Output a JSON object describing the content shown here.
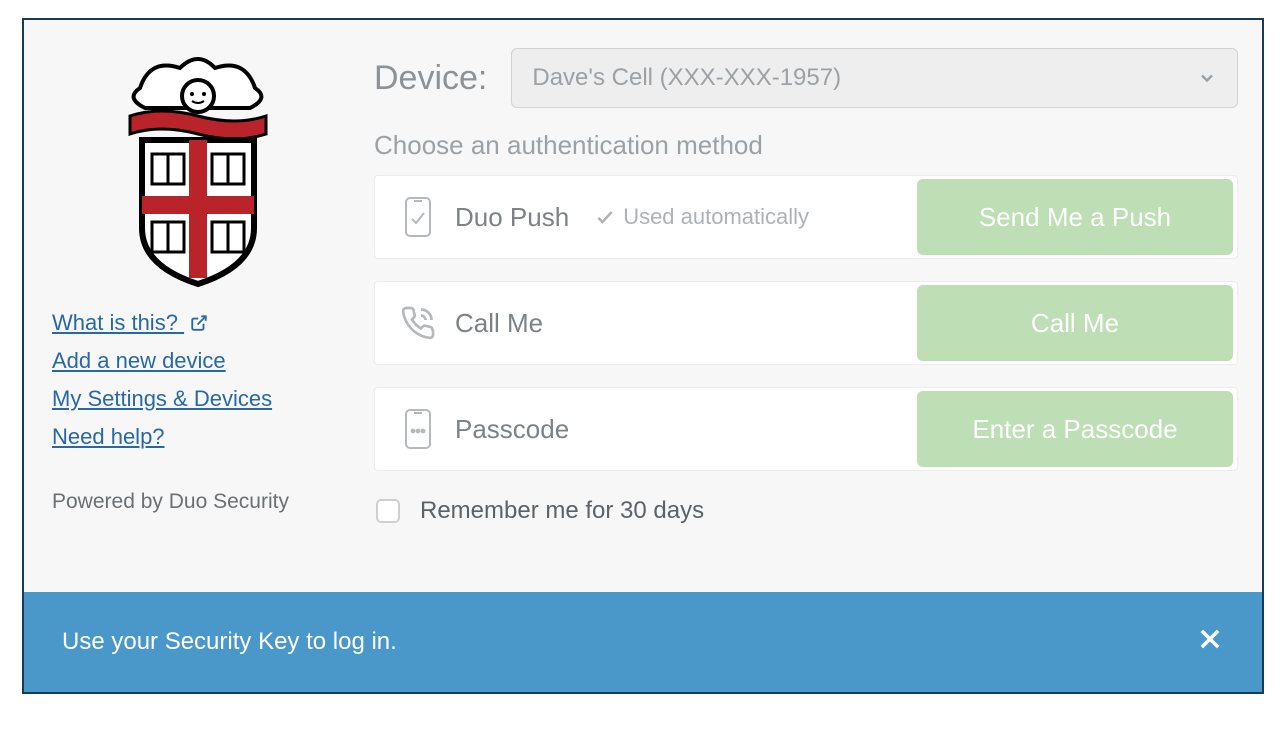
{
  "sidebar": {
    "links": {
      "what_is_this": "What is this?",
      "add_device": "Add a new device",
      "settings": "My Settings & Devices",
      "need_help": "Need help?"
    },
    "powered": "Powered by Duo Security"
  },
  "main": {
    "device_label": "Device:",
    "device_selected": "Dave's Cell (XXX-XXX-1957)",
    "instruction": "Choose an authentication method",
    "methods": {
      "push": {
        "label": "Duo Push",
        "note": "Used automatically",
        "action": "Send Me a Push"
      },
      "call": {
        "label": "Call Me",
        "action": "Call Me"
      },
      "passcode": {
        "label": "Passcode",
        "action": "Enter a Passcode"
      }
    },
    "remember": "Remember me for 30 days"
  },
  "banner": {
    "message": "Use your Security Key to log in."
  }
}
